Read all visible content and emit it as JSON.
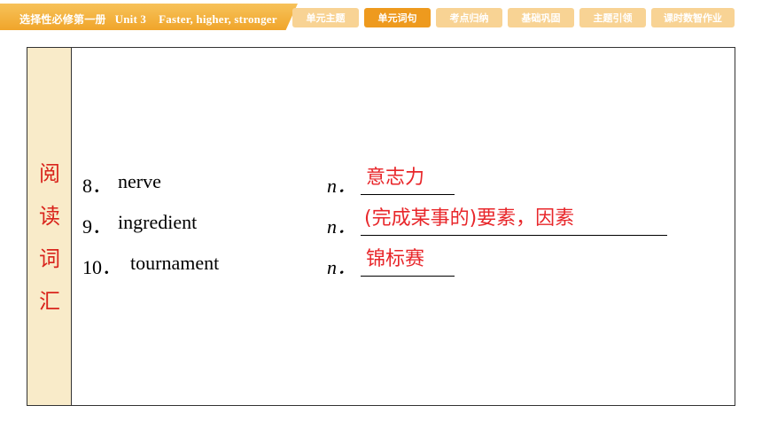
{
  "header": {
    "title_cn": "选择性必修第一册",
    "unit": "Unit 3",
    "title_en": "Faster, higher, stronger"
  },
  "tabs": [
    {
      "label": "单元主题",
      "active": false
    },
    {
      "label": "单元词句",
      "active": true
    },
    {
      "label": "考点归纳",
      "active": false
    },
    {
      "label": "基础巩固",
      "active": false
    },
    {
      "label": "主题引领",
      "active": false
    },
    {
      "label": "课时数智作业",
      "active": false
    }
  ],
  "sidebar": {
    "chars": [
      "阅",
      "读",
      "词",
      "汇"
    ]
  },
  "vocab": [
    {
      "num": "8．",
      "word": "nerve",
      "pos": "n．",
      "answer": "意志力"
    },
    {
      "num": "9．",
      "word": "ingredient",
      "pos": "n．",
      "answer": "(完成某事的)要素，因素"
    },
    {
      "num": "10．",
      "word": "tournament",
      "pos": "n．",
      "answer": "锦标赛"
    }
  ],
  "colors": {
    "accent": "#ee9a1e",
    "tab_inactive": "#f8d394",
    "sidebar_bg": "#f9ebc9",
    "answer": "#e8262a"
  }
}
